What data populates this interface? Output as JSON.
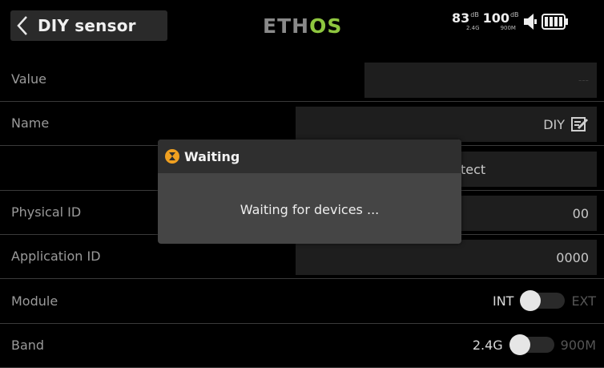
{
  "header": {
    "title": "DIY sensor",
    "logo": "ETHOS",
    "rssi": [
      {
        "value": "83",
        "unit": "dB",
        "band": "2.4G"
      },
      {
        "value": "100",
        "unit": "dB",
        "band": "900M"
      }
    ],
    "icons": [
      "speaker-icon",
      "battery-icon"
    ]
  },
  "rows": {
    "value": {
      "label": "Value",
      "field": "---"
    },
    "name": {
      "label": "Name",
      "field": "DIY"
    },
    "discover": {
      "label": "",
      "field": "tect"
    },
    "physical_id": {
      "label": "Physical ID",
      "field": "00"
    },
    "application_id": {
      "label": "Application ID",
      "field": "0000"
    },
    "module": {
      "label": "Module",
      "left_option": "INT",
      "right_option": "EXT",
      "selected": "INT"
    },
    "band": {
      "label": "Band",
      "left_option": "2.4G",
      "right_option": "900M",
      "selected": "2.4G"
    }
  },
  "dialog": {
    "title": "Waiting",
    "message": "Waiting for devices ...",
    "icon": "hourglass-icon"
  },
  "colors": {
    "logo_green": "#8ec63f",
    "dialog_icon": "#f0a020",
    "dialog_body": "#454545",
    "dialog_header": "#2f2f2f"
  }
}
